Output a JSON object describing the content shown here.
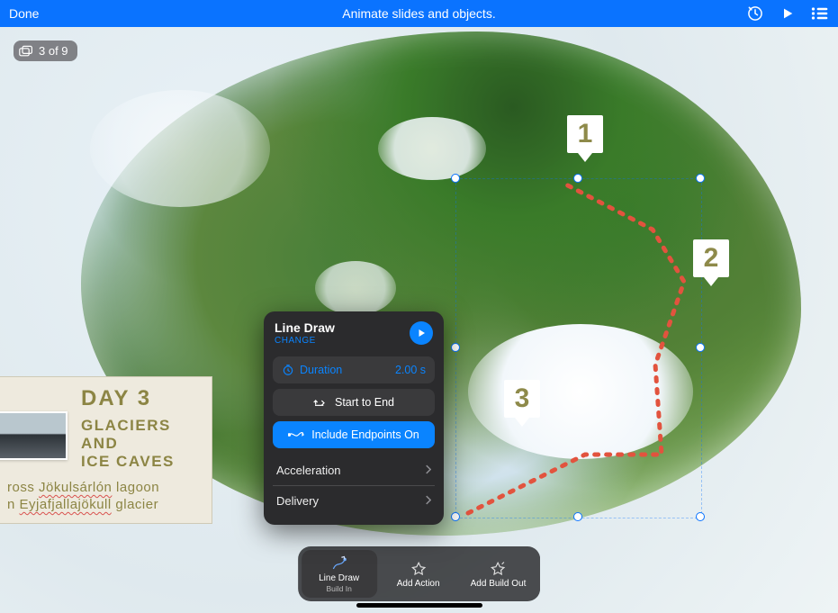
{
  "topbar": {
    "done": "Done",
    "title": "Animate slides and objects."
  },
  "slide_counter": {
    "label": "3 of 9"
  },
  "pins": [
    "1",
    "2",
    "3"
  ],
  "day_card": {
    "title": "DAY 3",
    "subtitle": "GLACIERS AND\nICE CAVES",
    "line1_prefix": "ross ",
    "line1_wavy": "Jökulsárlón",
    "line1_suffix": " lagoon",
    "line2_prefix": "n ",
    "line2_wavy": "Eyjafjallajökull",
    "line2_suffix": " glacier"
  },
  "panel": {
    "title": "Line Draw",
    "change": "CHANGE",
    "duration_label": "Duration",
    "duration_value": "2.00 s",
    "direction": "Start to End",
    "endpoints": "Include Endpoints On",
    "acceleration": "Acceleration",
    "delivery": "Delivery"
  },
  "anim_bar": {
    "build_in_label": "Line Draw",
    "build_in_sub": "Build In",
    "add_action": "Add Action",
    "add_build_out": "Add Build Out"
  }
}
